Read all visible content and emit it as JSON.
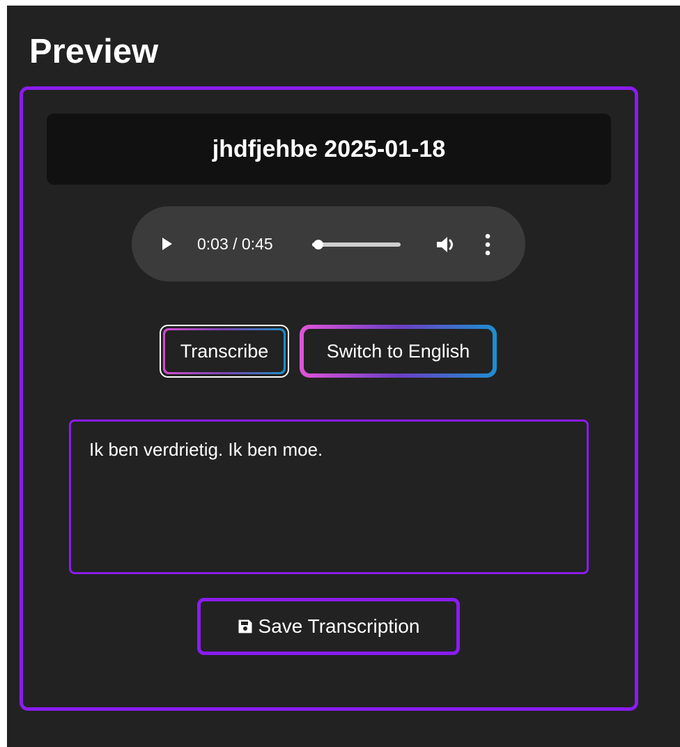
{
  "page": {
    "title": "Preview"
  },
  "recording": {
    "title": "jhdfjehbe 2025-01-18"
  },
  "audio_player": {
    "time_display": "0:03 / 0:45",
    "progress_fraction": 0.067,
    "icons": {
      "play": "play-icon",
      "volume": "volume-icon",
      "more": "more-options-icon"
    }
  },
  "actions": {
    "transcribe_label": "Transcribe",
    "switch_language_label": "Switch to English"
  },
  "transcription": {
    "text": "Ik ben verdrietig. Ik ben moe."
  },
  "save": {
    "label": "Save Transcription",
    "icon": "floppy-disk-icon"
  },
  "colors": {
    "background": "#222222",
    "accent_purple": "#8a1cf0",
    "panel_dark": "#111111",
    "player_bg": "#3b3b3b",
    "gradient_start": "#e055d8",
    "gradient_end": "#1e8fcf"
  }
}
